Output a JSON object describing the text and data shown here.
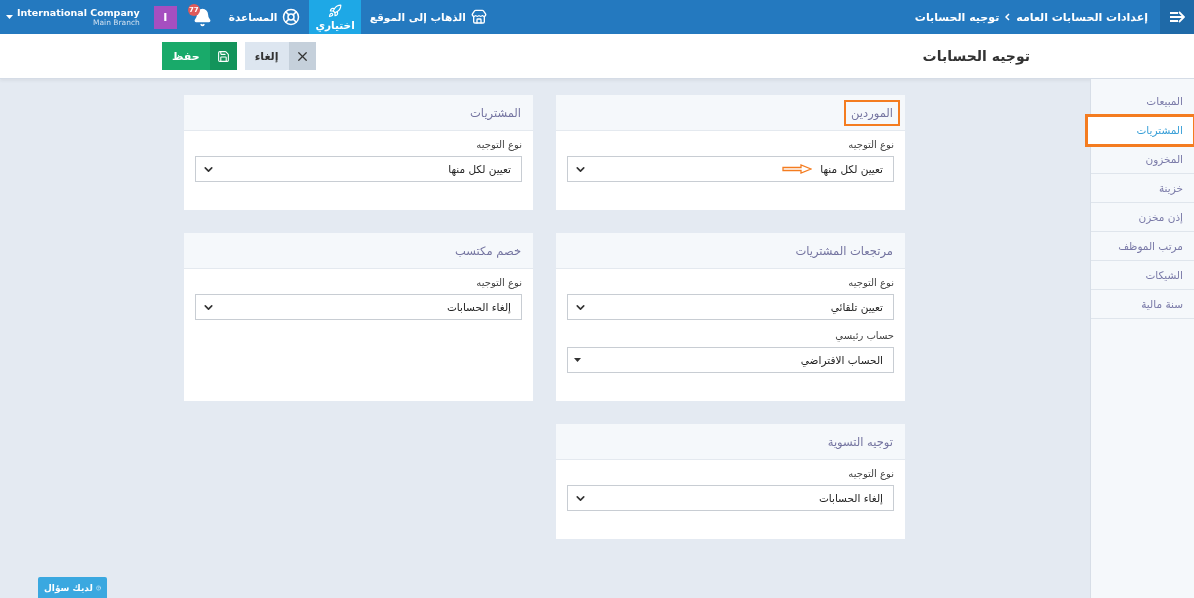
{
  "topbar": {
    "breadcrumb": [
      {
        "label": "إعدادات الحسابات العامه"
      },
      {
        "label": "توجيه الحسابات"
      }
    ],
    "nav": [
      {
        "label": "الذهاب إلى الموقع",
        "kind": "store",
        "selected": false
      },
      {
        "label": "اختياري",
        "kind": "rocket",
        "selected": true
      },
      {
        "label": "المساعدة",
        "kind": "help",
        "selected": false
      }
    ],
    "notifications": {
      "badge": "77"
    },
    "avatar": {
      "initial": "I"
    },
    "company": {
      "name": "International Company",
      "branch": "Main Branch"
    }
  },
  "header": {
    "title": "توجيه الحسابات",
    "buttons": [
      {
        "label": "إلغاء",
        "kind": "cancel"
      },
      {
        "label": "حفظ",
        "kind": "save"
      }
    ]
  },
  "sidebar": {
    "items": [
      {
        "label": "المبيعات",
        "selected": false,
        "highlighted": false
      },
      {
        "label": "المشتريات",
        "selected": true,
        "highlighted": true
      },
      {
        "label": "المخزون",
        "selected": false,
        "highlighted": false
      },
      {
        "label": "خزينة",
        "selected": false,
        "highlighted": false
      },
      {
        "label": "إذن مخزن",
        "selected": false,
        "highlighted": false
      },
      {
        "label": "مرتب الموظف",
        "selected": false,
        "highlighted": false
      },
      {
        "label": "الشيكات",
        "selected": false,
        "highlighted": false
      },
      {
        "label": "سنة مالية",
        "selected": false,
        "highlighted": false
      }
    ]
  },
  "cards": [
    {
      "title": "الموردين",
      "highlighted": true,
      "fields": [
        {
          "label": "نوع التوجيه",
          "value": "تعيين لكل منها",
          "kind": "select",
          "annotated": true
        }
      ]
    },
    {
      "title": "المشتريات",
      "highlighted": false,
      "fields": [
        {
          "label": "نوع التوجيه",
          "value": "تعيين لكل منها",
          "kind": "select",
          "annotated": false
        }
      ]
    },
    {
      "title": "مرتجعات المشتريات",
      "highlighted": false,
      "fields": [
        {
          "label": "نوع التوجيه",
          "value": "تعيين تلقائي",
          "kind": "select",
          "annotated": false
        },
        {
          "label": "حساب رئيسي",
          "value": "الحساب الافتراضي",
          "kind": "dropdown",
          "annotated": false
        }
      ]
    },
    {
      "title": "خصم مكتسب",
      "highlighted": false,
      "fields": [
        {
          "label": "نوع التوجيه",
          "value": "إلغاء الحسابات",
          "kind": "select",
          "annotated": false
        }
      ]
    },
    {
      "title": "توجيه التسوية",
      "highlighted": false,
      "fields": [
        {
          "label": "نوع التوجيه",
          "value": "إلغاء الحسابات",
          "kind": "select",
          "annotated": false
        }
      ]
    }
  ],
  "help_button": {
    "label": "لديك سؤال"
  }
}
